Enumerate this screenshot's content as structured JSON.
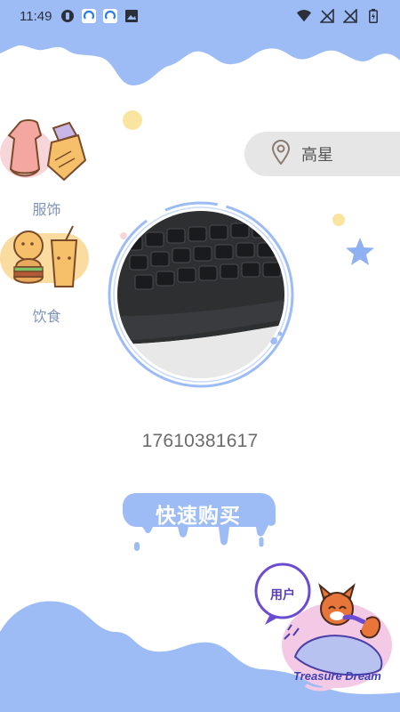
{
  "status_bar": {
    "time": "11:49",
    "left_icons": [
      "app-icon",
      "sync-icon",
      "sync-icon",
      "image-icon"
    ],
    "right_icons": [
      "wifi-icon",
      "no-signal-icon",
      "no-signal-icon",
      "battery-icon"
    ]
  },
  "categories": [
    {
      "label": "服饰",
      "icon": "clothing-icon"
    },
    {
      "label": "饮食",
      "icon": "food-icon"
    }
  ],
  "location": {
    "icon": "location-pin-icon",
    "text": "高星"
  },
  "profile": {
    "phone": "17610381617"
  },
  "buy_button": {
    "label": "快速购买"
  },
  "user_badge": {
    "label": "用户",
    "brand": "Treasure Dream"
  },
  "colors": {
    "accent_blue": "#9dbcf6",
    "location_bg": "#e6e6e6",
    "label_blue": "#7f93b8",
    "dot_yellow": "#f9e5a0",
    "star_blue": "#8fb1f2"
  }
}
